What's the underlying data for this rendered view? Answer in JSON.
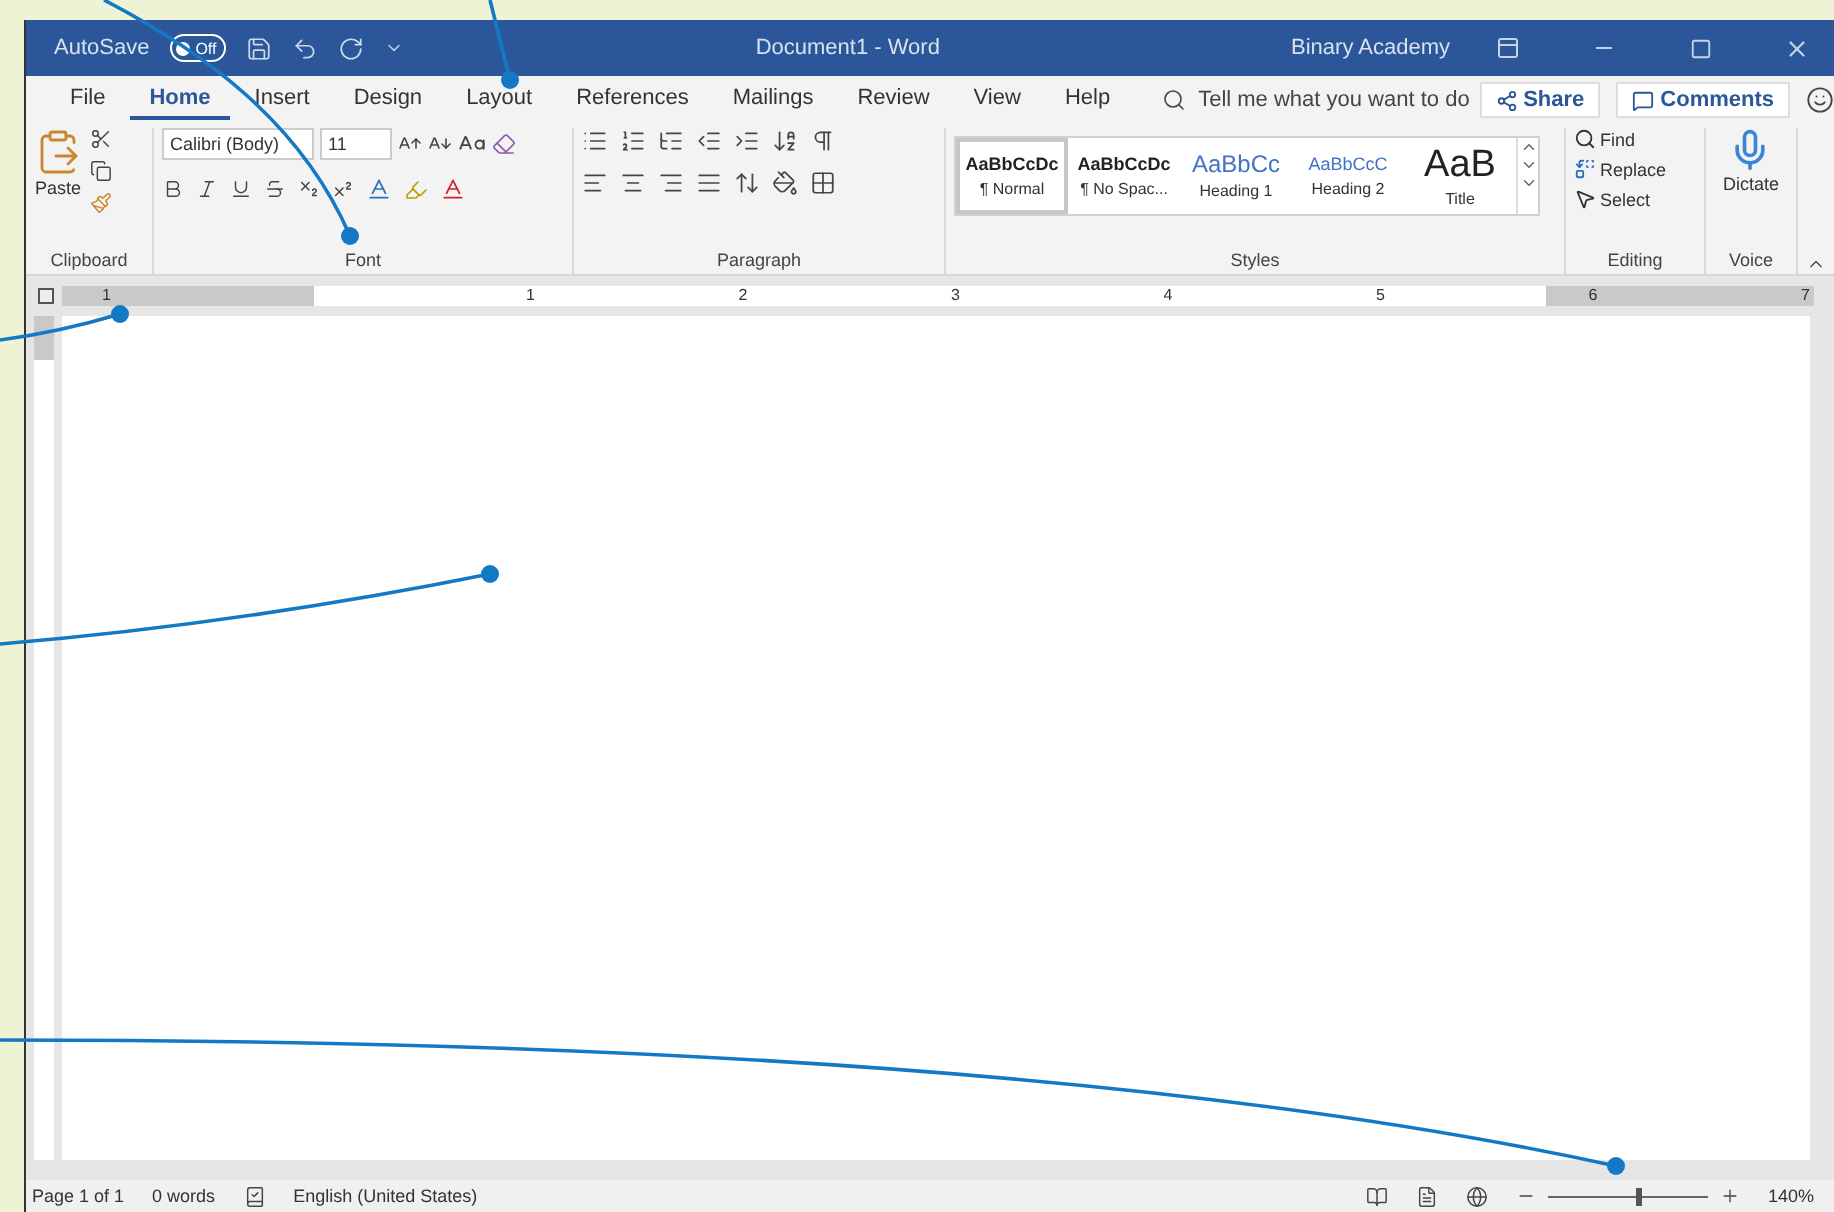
{
  "title_bar": {
    "autosave": {
      "label": "AutoSave",
      "toggle_label": "Off",
      "on": false
    },
    "title": "Document1 - Word",
    "user": "Binary Academy"
  },
  "tabs": [
    {
      "label": "File",
      "selected": false
    },
    {
      "label": "Home",
      "selected": true
    },
    {
      "label": "Insert",
      "selected": false
    },
    {
      "label": "Design",
      "selected": false
    },
    {
      "label": "Layout",
      "selected": false
    },
    {
      "label": "References",
      "selected": false
    },
    {
      "label": "Mailings",
      "selected": false
    },
    {
      "label": "Review",
      "selected": false
    },
    {
      "label": "View",
      "selected": false
    },
    {
      "label": "Help",
      "selected": false
    }
  ],
  "tell_me": {
    "placeholder": "Tell me what you want to do"
  },
  "share_button": "Share",
  "comments_button": "Comments",
  "ribbon": {
    "clipboard": {
      "label": "Clipboard",
      "paste": "Paste"
    },
    "font": {
      "label": "Font",
      "font_name": "Calibri (Body)",
      "font_size": "11"
    },
    "paragraph": {
      "label": "Paragraph"
    },
    "styles": {
      "label": "Styles",
      "items": [
        {
          "preview": "AaBbCcDc",
          "name": "¶ Normal",
          "kind": "normal",
          "selected": true
        },
        {
          "preview": "AaBbCcDc",
          "name": "¶ No Spac...",
          "kind": "normal",
          "selected": false
        },
        {
          "preview": "AaBbCc",
          "name": "Heading 1",
          "kind": "heading1",
          "selected": false
        },
        {
          "preview": "AaBbCcC",
          "name": "Heading 2",
          "kind": "heading2",
          "selected": false
        },
        {
          "preview": "AaB",
          "name": "Title",
          "kind": "title",
          "selected": false
        }
      ]
    },
    "editing": {
      "label": "Editing",
      "find": "Find",
      "replace": "Replace",
      "select": "Select"
    },
    "voice": {
      "label": "Voice",
      "dictate": "Dictate"
    }
  },
  "ruler": {
    "numbers": [
      "1",
      "1",
      "2",
      "3",
      "4",
      "5",
      "6",
      "7"
    ]
  },
  "status_bar": {
    "page": "Page 1 of 1",
    "words": "0 words",
    "language": "English (United States)",
    "zoom": "140%",
    "zoom_level": {
      "level": 0.55
    }
  }
}
